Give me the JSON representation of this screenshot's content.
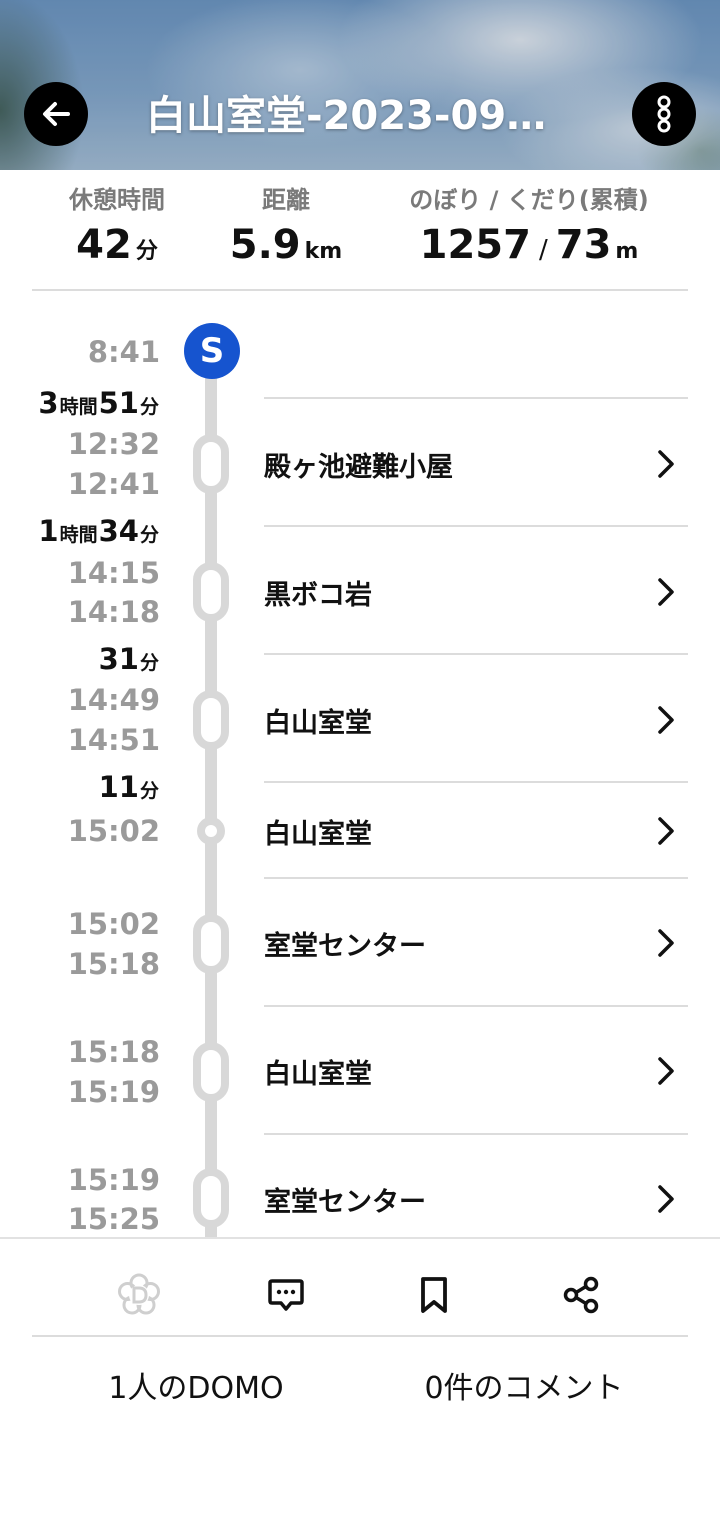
{
  "header": {
    "title": "白山室堂-2023-09…",
    "back_icon": "arrow-left-icon",
    "menu_icon": "more-vertical-icon"
  },
  "stats": {
    "rest_label": "休憩時間",
    "rest_value": "42",
    "rest_unit": "分",
    "distance_label": "距離",
    "distance_value": "5.9",
    "distance_unit": "km",
    "elevation_label": "のぼり / くだり(累積)",
    "ascent_value": "1257",
    "descent_value": "73",
    "elevation_unit": "m",
    "slash": "/"
  },
  "timeline": {
    "start_badge": "S",
    "start_time": "8:41",
    "durations": [
      {
        "h": "3",
        "h_unit": "時間",
        "m": "51",
        "m_unit": "分"
      },
      {
        "h": "1",
        "h_unit": "時間",
        "m": "34",
        "m_unit": "分"
      },
      {
        "m": "31",
        "m_unit": "分"
      },
      {
        "m": "11",
        "m_unit": "分"
      }
    ],
    "stops": [
      {
        "arrive": "12:32",
        "depart": "12:41",
        "name": "殿ヶ池避難小屋"
      },
      {
        "arrive": "14:15",
        "depart": "14:18",
        "name": "黒ボコ岩"
      },
      {
        "arrive": "14:49",
        "depart": "14:51",
        "name": "白山室堂"
      },
      {
        "arrive": "15:02",
        "name": "白山室堂"
      },
      {
        "arrive": "15:02",
        "depart": "15:18",
        "name": "室堂センター"
      },
      {
        "arrive": "15:18",
        "depart": "15:19",
        "name": "白山室堂"
      },
      {
        "arrive": "15:19",
        "depart": "15:25",
        "name": "室堂センター"
      }
    ]
  },
  "bottom": {
    "icons": [
      "domo-flower-icon",
      "comment-icon",
      "bookmark-icon",
      "share-icon"
    ],
    "domo_text": "1人のDOMO",
    "comment_text": "0件のコメント"
  },
  "colors": {
    "accent": "#1654cf",
    "timeline": "#d8d8d8",
    "muted_text": "#9a9a9a"
  }
}
